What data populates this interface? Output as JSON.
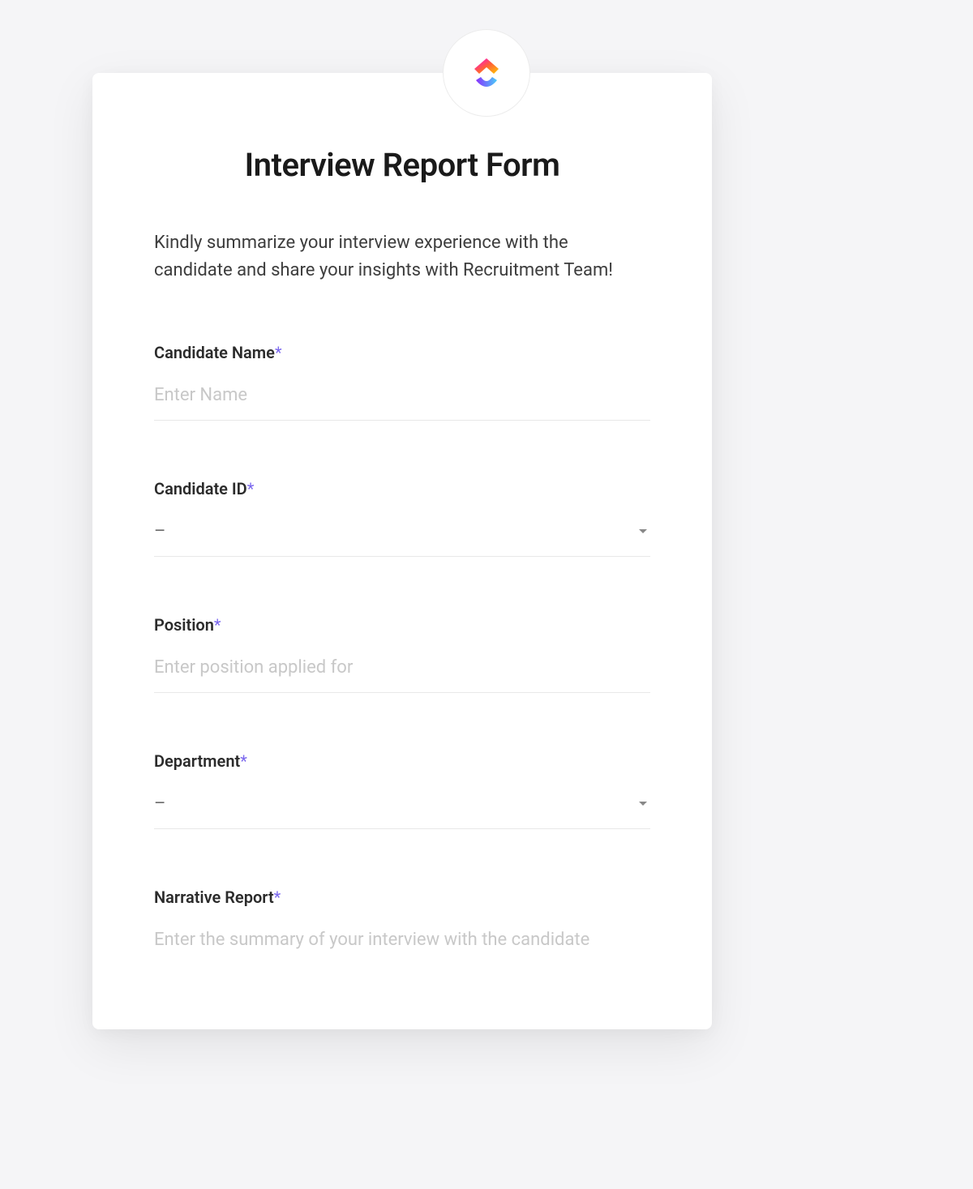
{
  "form": {
    "title": "Interview Report Form",
    "description": "Kindly summarize your interview experience with the candidate and share your insights with Recruitment Team!",
    "fields": {
      "candidate_name": {
        "label": "Candidate Name",
        "required_mark": "*",
        "placeholder": "Enter Name",
        "value": ""
      },
      "candidate_id": {
        "label": "Candidate ID",
        "required_mark": "*",
        "selected": "–"
      },
      "position": {
        "label": "Position",
        "required_mark": "*",
        "placeholder": "Enter position applied for",
        "value": ""
      },
      "department": {
        "label": "Department",
        "required_mark": "*",
        "selected": "–"
      },
      "narrative_report": {
        "label": "Narrative Report",
        "required_mark": "*",
        "placeholder": "Enter the summary of your interview with the candidate"
      }
    }
  }
}
